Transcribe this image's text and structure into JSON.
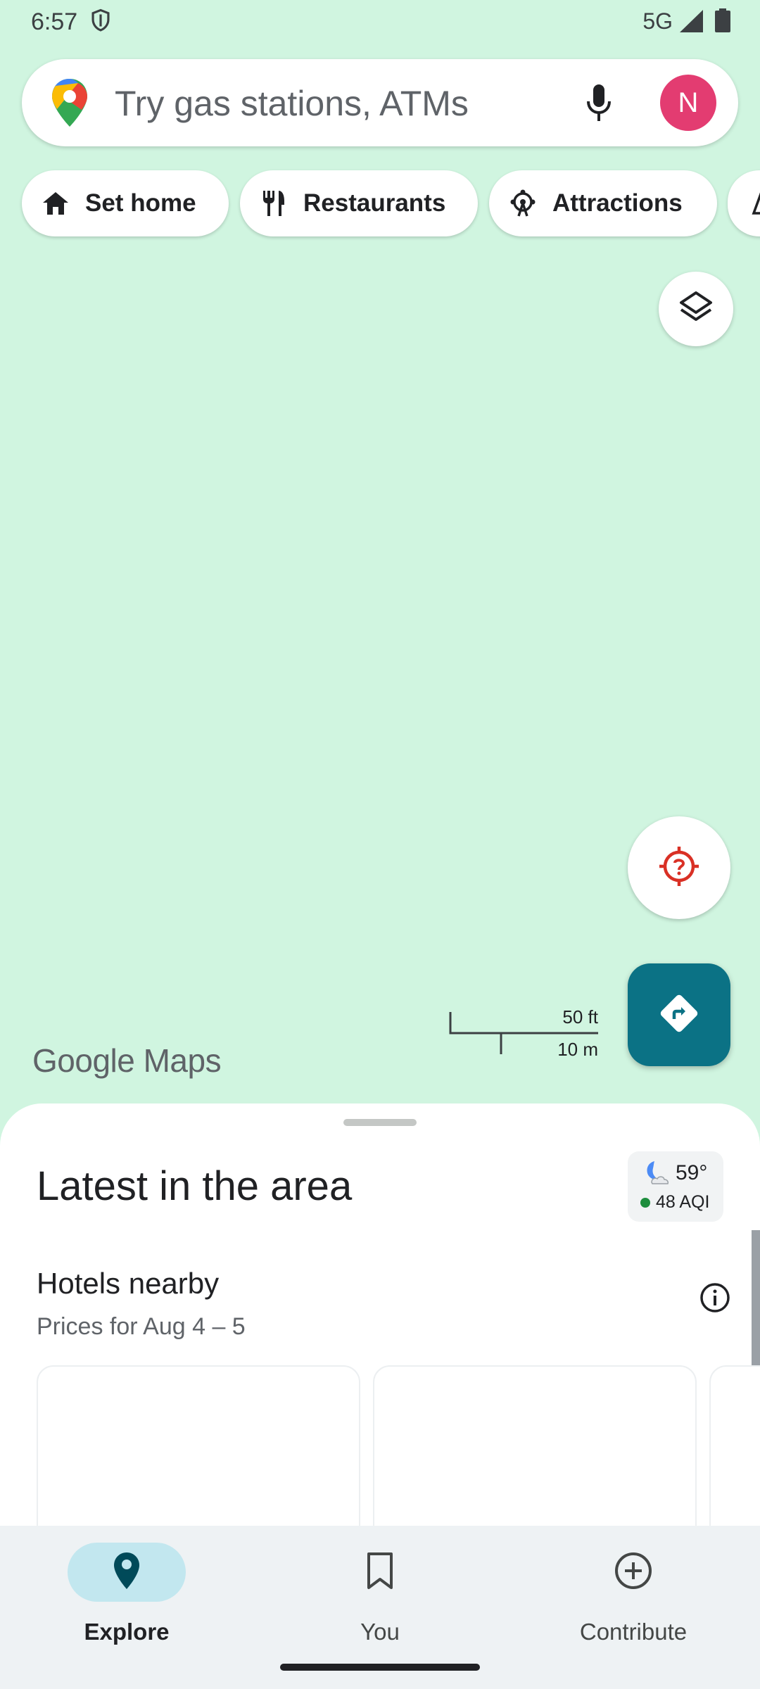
{
  "status_bar": {
    "time": "6:57",
    "network": "5G"
  },
  "search": {
    "placeholder": "Try gas stations, ATMs",
    "avatar_initial": "N"
  },
  "chips": [
    {
      "label": "Set home",
      "icon": "home-icon"
    },
    {
      "label": "Restaurants",
      "icon": "fork-knife-icon"
    },
    {
      "label": "Attractions",
      "icon": "ferris-wheel-icon"
    }
  ],
  "map": {
    "scale_ft": "50 ft",
    "scale_m": "10 m",
    "logo": "Google Maps",
    "colors": {
      "map_bg": "#d0f5e0",
      "directions": "#0b7285",
      "locate_icon": "#d93025"
    }
  },
  "sheet": {
    "title": "Latest in the area",
    "weather_temp": "59°",
    "weather_aqi": "48 AQI",
    "section_title": "Hotels nearby",
    "section_subtitle": "Prices for Aug 4 – 5"
  },
  "nav": {
    "items": [
      {
        "label": "Explore",
        "icon": "location-pin-icon",
        "active": true
      },
      {
        "label": "You",
        "icon": "bookmark-icon",
        "active": false
      },
      {
        "label": "Contribute",
        "icon": "add-circle-icon",
        "active": false
      }
    ]
  }
}
